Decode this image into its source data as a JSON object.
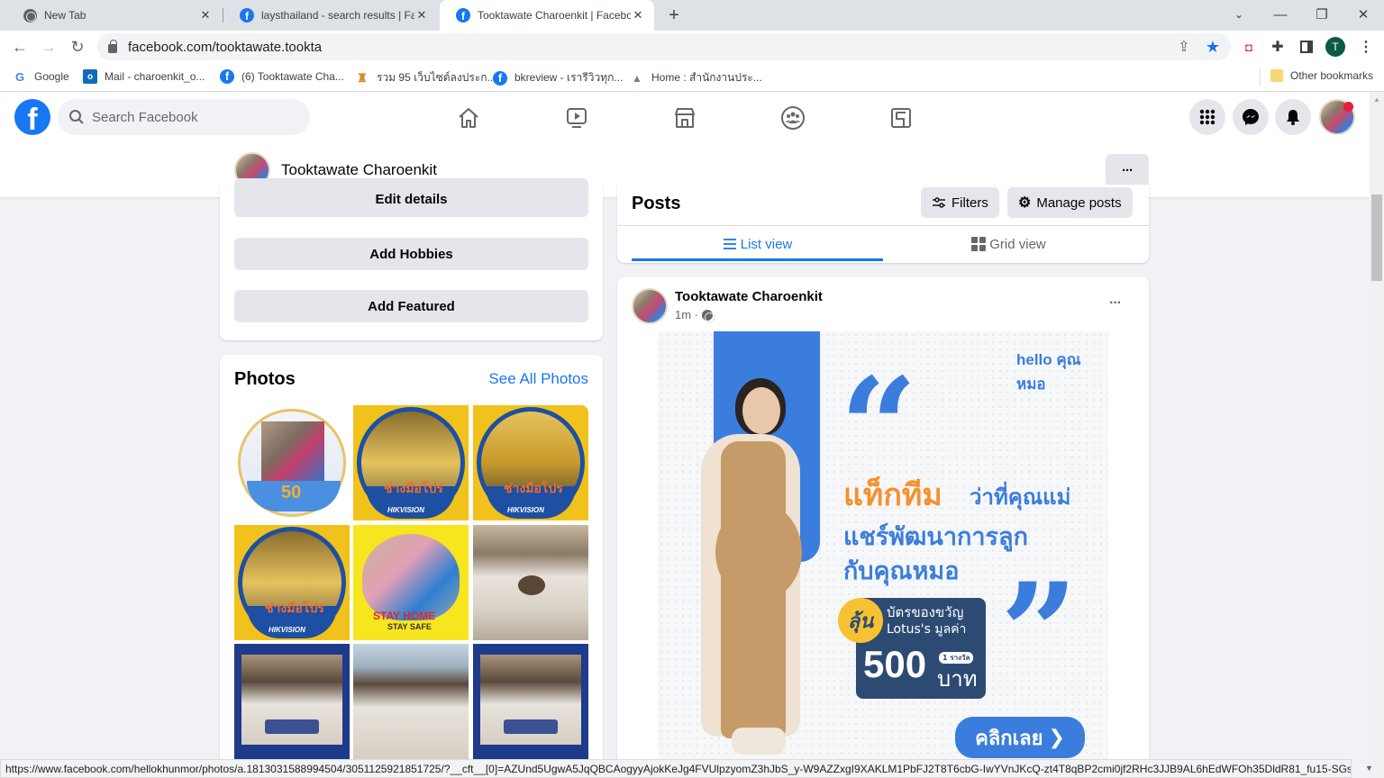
{
  "browser": {
    "tabs": [
      {
        "label": "New Tab",
        "icon": "globe-icon",
        "active": false
      },
      {
        "label": "laysthailand - search results | Facebook",
        "icon": "facebook-icon",
        "active": false
      },
      {
        "label": "Tooktawate Charoenkit | Facebook",
        "icon": "facebook-icon",
        "active": true
      }
    ],
    "new_tab_label": "+",
    "url": "facebook.com/tooktawate.tookta",
    "profile_initial": "T",
    "bookmarks": [
      {
        "label": "Google",
        "icon": "google-icon"
      },
      {
        "label": "Mail - charoenkit_o...",
        "icon": "outlook-icon"
      },
      {
        "label": "(6) Tooktawate Cha...",
        "icon": "facebook-icon"
      },
      {
        "label": "รวม 95 เว็บไซต์ลงประก...",
        "icon": "bookmark-site-icon"
      },
      {
        "label": "bkreview - เรารีวิวทุก...",
        "icon": "facebook-icon"
      },
      {
        "label": "Home : สำนักงานประ...",
        "icon": "triangle-logo-icon"
      }
    ],
    "other_bookmarks": "Other bookmarks",
    "status_url": "https://www.facebook.com/hellokhunmor/photos/a.1813031588994504/3051125921851725/?__cft__[0]=AZUnd5UgwA5JqQBCAogyyAjokKeJg4FVUlpzyomZ3hJbS_y-W9AZZxgI9XAKLM1PbFJ2T8T6cbG-IwYVnJKcQ-zt4T8qBP2cmi0jf2RHc3JJB9AL6hEdWFOh35DldR81_fu15-SGsLXbrWi4..."
  },
  "fb": {
    "search_placeholder": "Search Facebook",
    "nav": [
      "home-icon",
      "watch-icon",
      "marketplace-icon",
      "groups-icon",
      "gaming-icon"
    ],
    "profile_name": "Tooktawate Charoenkit",
    "more_label": "···",
    "intro": {
      "buttons": [
        "Edit details",
        "Add Hobbies",
        "Add Featured"
      ]
    },
    "photos": {
      "title": "Photos",
      "see_all": "See All Photos",
      "items": [
        {
          "label": "50th anniversary frame photo",
          "caption": ""
        },
        {
          "label": "ช่างมือโปร Hikvision frame",
          "caption": "ช่างมือโปร"
        },
        {
          "label": "ช่างมือโปร Hikvision frame",
          "caption": "ช่างมือโปร"
        },
        {
          "label": "ช่างมือโปร Hikvision frame",
          "caption": "ช่างมือโปร"
        },
        {
          "label": "Stay Home Stay Safe frame",
          "caption": "STAY HOME"
        },
        {
          "label": "Sleeping photo",
          "caption": ""
        },
        {
          "label": "Picasso frame sleeping",
          "caption": ""
        },
        {
          "label": "Sleeping photo",
          "caption": ""
        },
        {
          "label": "Picasso frame sleeping",
          "caption": ""
        }
      ],
      "sub_caption_stay": "STAY SAFE",
      "brand": "HIKVISION"
    },
    "posts": {
      "title": "Posts",
      "filters": "Filters",
      "manage": "Manage posts",
      "tabs": [
        {
          "label": "List view",
          "active": true
        },
        {
          "label": "Grid view",
          "active": false
        }
      ]
    },
    "post": {
      "author": "Tooktawate Charoenkit",
      "time": "1m ·",
      "privacy_icon": "globe-icon",
      "ad": {
        "brand": "hello คุณหมอ",
        "headline_orange": "แท็กทีม",
        "headline_blue1": "ว่าที่คุณแม่",
        "headline_blue2": "แชร์พัฒนาการลูก",
        "headline_blue3": "กับคุณหมอ",
        "badge": "ลุ้น",
        "prize_line1": "บัตรของขวัญ",
        "prize_line2": "Lotus's มูลค่า",
        "prize_amount": "500",
        "prize_unit": "บาท",
        "prize_count": "1 รางวัล",
        "cta": "คลิกเลย",
        "open_quote": "“",
        "close_quote": "”"
      }
    }
  },
  "colors": {
    "fb_blue": "#1877f2",
    "ad_blue": "#3b7ddd",
    "ad_orange": "#f5912b",
    "ad_navy": "#2d4a73",
    "ad_yellow": "#f7c232"
  }
}
